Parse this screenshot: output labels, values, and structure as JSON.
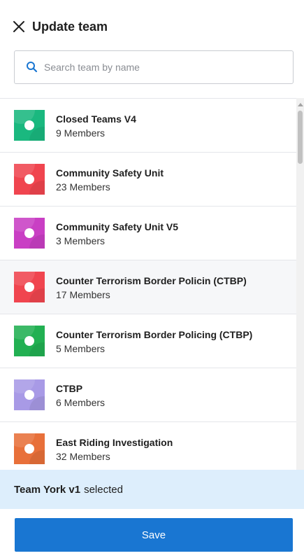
{
  "header": {
    "title": "Update team",
    "close_icon": "close-icon"
  },
  "search": {
    "placeholder": "Search team by name",
    "value": "",
    "icon": "search-icon",
    "icon_color": "#1976d2"
  },
  "teams": [
    {
      "name": "Closed Teams V4",
      "members": "9 Members",
      "color": "#1ab87f",
      "highlighted": false
    },
    {
      "name": "Community Safety Unit",
      "members": "23 Members",
      "color": "#f0454f",
      "highlighted": false
    },
    {
      "name": "Community Safety Unit V5",
      "members": "3 Members",
      "color": "#c93fc4",
      "highlighted": false
    },
    {
      "name": "Counter Terrorism Border Policin (CTBP)",
      "members": "17 Members",
      "color": "#f0454f",
      "highlighted": true
    },
    {
      "name": "Counter Terrorism Border Policing (CTBP)",
      "members": "5 Members",
      "color": "#22b052",
      "highlighted": false
    },
    {
      "name": "CTBP",
      "members": "6 Members",
      "color": "#a89ae6",
      "highlighted": false
    },
    {
      "name": "East Riding Investigation",
      "members": "32 Members",
      "color": "#e8703a",
      "highlighted": false
    }
  ],
  "selection": {
    "team": "Team York v1",
    "suffix": "selected"
  },
  "footer": {
    "save_label": "Save",
    "save_color": "#1976d2"
  }
}
